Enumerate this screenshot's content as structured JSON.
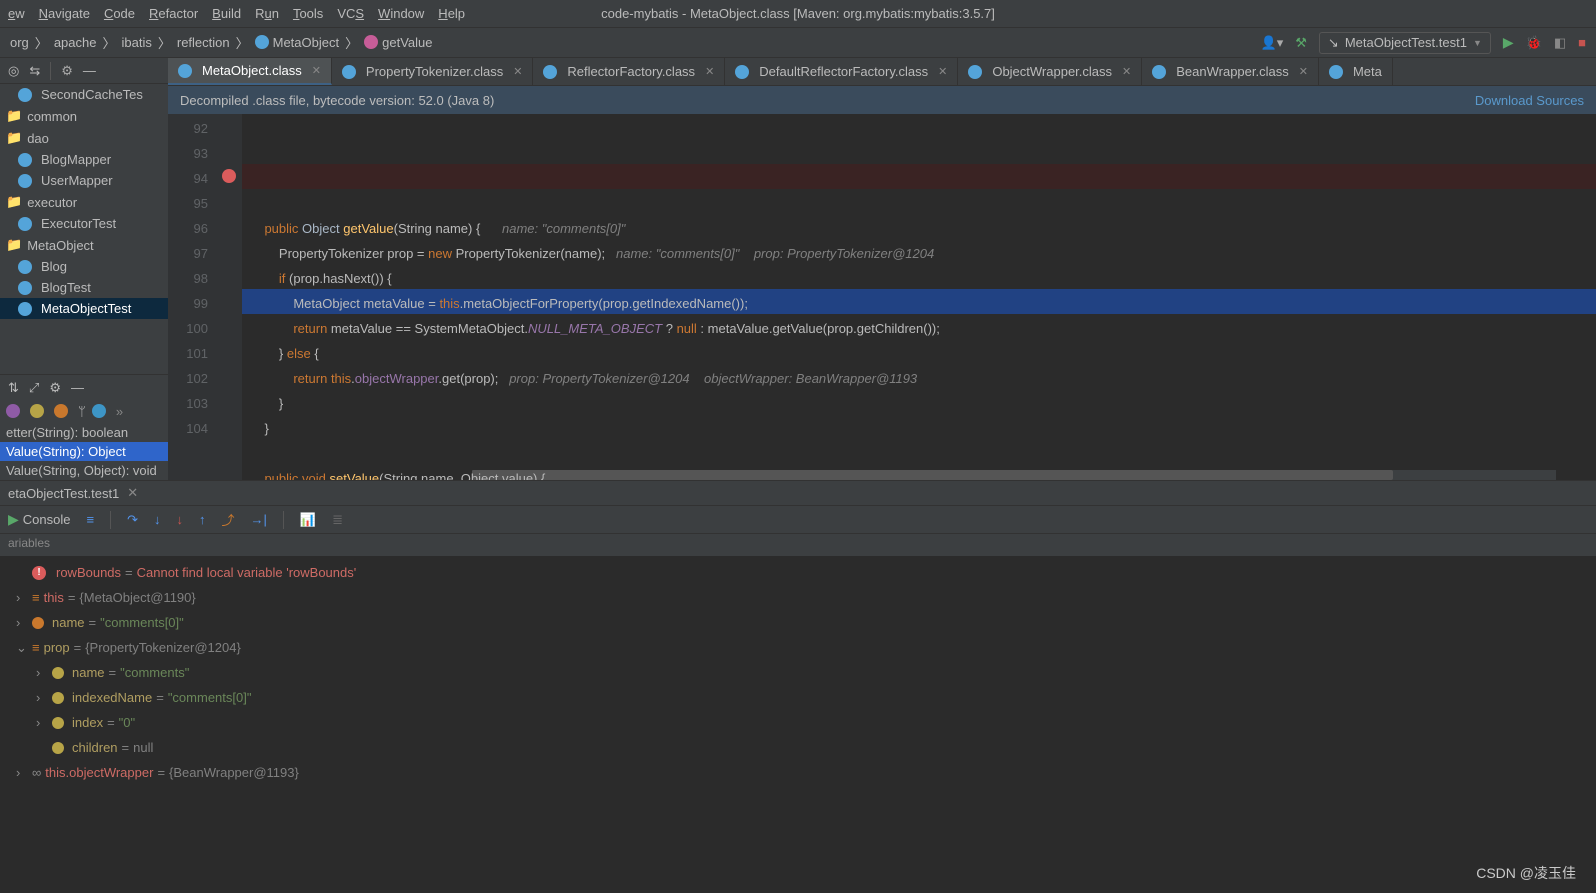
{
  "menu": {
    "items": [
      "ew",
      "Navigate",
      "Code",
      "Refactor",
      "Build",
      "Run",
      "Tools",
      "VCS",
      "Window",
      "Help"
    ]
  },
  "window_title": "code-mybatis - MetaObject.class [Maven: org.mybatis:mybatis:3.5.7]",
  "breadcrumbs": [
    "org",
    "apache",
    "ibatis",
    "reflection",
    "MetaObject",
    "getValue"
  ],
  "run_config": "MetaObjectTest.test1",
  "sidebar": {
    "items": [
      {
        "label": "SecondCacheTes",
        "cls": "ico-blue"
      },
      {
        "label": "common",
        "cls": "folder"
      },
      {
        "label": "dao",
        "cls": "folder"
      },
      {
        "label": "BlogMapper",
        "cls": "ico-blue"
      },
      {
        "label": "UserMapper",
        "cls": "ico-blue"
      },
      {
        "label": "executor",
        "cls": "folder"
      },
      {
        "label": "ExecutorTest",
        "cls": "ico-blue"
      },
      {
        "label": "MetaObject",
        "cls": "folder"
      },
      {
        "label": "Blog",
        "cls": "ico-blue"
      },
      {
        "label": "BlogTest",
        "cls": "ico-blue"
      },
      {
        "label": "MetaObjectTest",
        "cls": "ico-blue",
        "sel": true
      }
    ],
    "struct": [
      {
        "label": "etter(String): boolean"
      },
      {
        "label": "Value(String): Object",
        "sel": true
      },
      {
        "label": "Value(String, Object): void"
      }
    ]
  },
  "tabs": [
    {
      "label": "MetaObject.class",
      "active": true
    },
    {
      "label": "PropertyTokenizer.class"
    },
    {
      "label": "ReflectorFactory.class"
    },
    {
      "label": "DefaultReflectorFactory.class"
    },
    {
      "label": "ObjectWrapper.class"
    },
    {
      "label": "BeanWrapper.class"
    },
    {
      "label": "Meta"
    }
  ],
  "notice": {
    "msg": "Decompiled .class file, bytecode version: 52.0 (Java 8)",
    "link": "Download Sources"
  },
  "gutter": [
    "92",
    "93",
    "94",
    "95",
    "96",
    "97",
    "98",
    "99",
    "100",
    "101",
    "102",
    "103",
    "104"
  ],
  "code_hints": {
    "l93": "   name: \"comments[0]\"",
    "l94a": "name: \"comments[0]\"",
    "l94b": "prop: PropertyTokenizer@1204",
    "l99a": "prop: PropertyTokenizer@1204",
    "l99b": "objectWrapper: BeanWrapper@1193"
  },
  "debug_tab": "etaObjectTest.test1",
  "console_label": "Console",
  "var_head": "ariables",
  "variables": {
    "err": {
      "name": "rowBounds",
      "msg": "Cannot find local variable 'rowBounds'"
    },
    "this": {
      "name": "this",
      "val": "{MetaObject@1190}"
    },
    "name": {
      "name": "name",
      "val": "\"comments[0]\""
    },
    "prop": {
      "name": "prop",
      "val": "{PropertyTokenizer@1204}"
    },
    "prop_children": [
      {
        "name": "name",
        "val": "\"comments\"",
        "ico": "f"
      },
      {
        "name": "indexedName",
        "val": "\"comments[0]\"",
        "ico": "f"
      },
      {
        "name": "index",
        "val": "\"0\"",
        "ico": "f"
      },
      {
        "name": "children",
        "val": "null",
        "ico": "f"
      }
    ],
    "ow": {
      "name": "this.objectWrapper",
      "val": "{BeanWrapper@1193}"
    }
  },
  "watermark": "CSDN @凌玉佳"
}
